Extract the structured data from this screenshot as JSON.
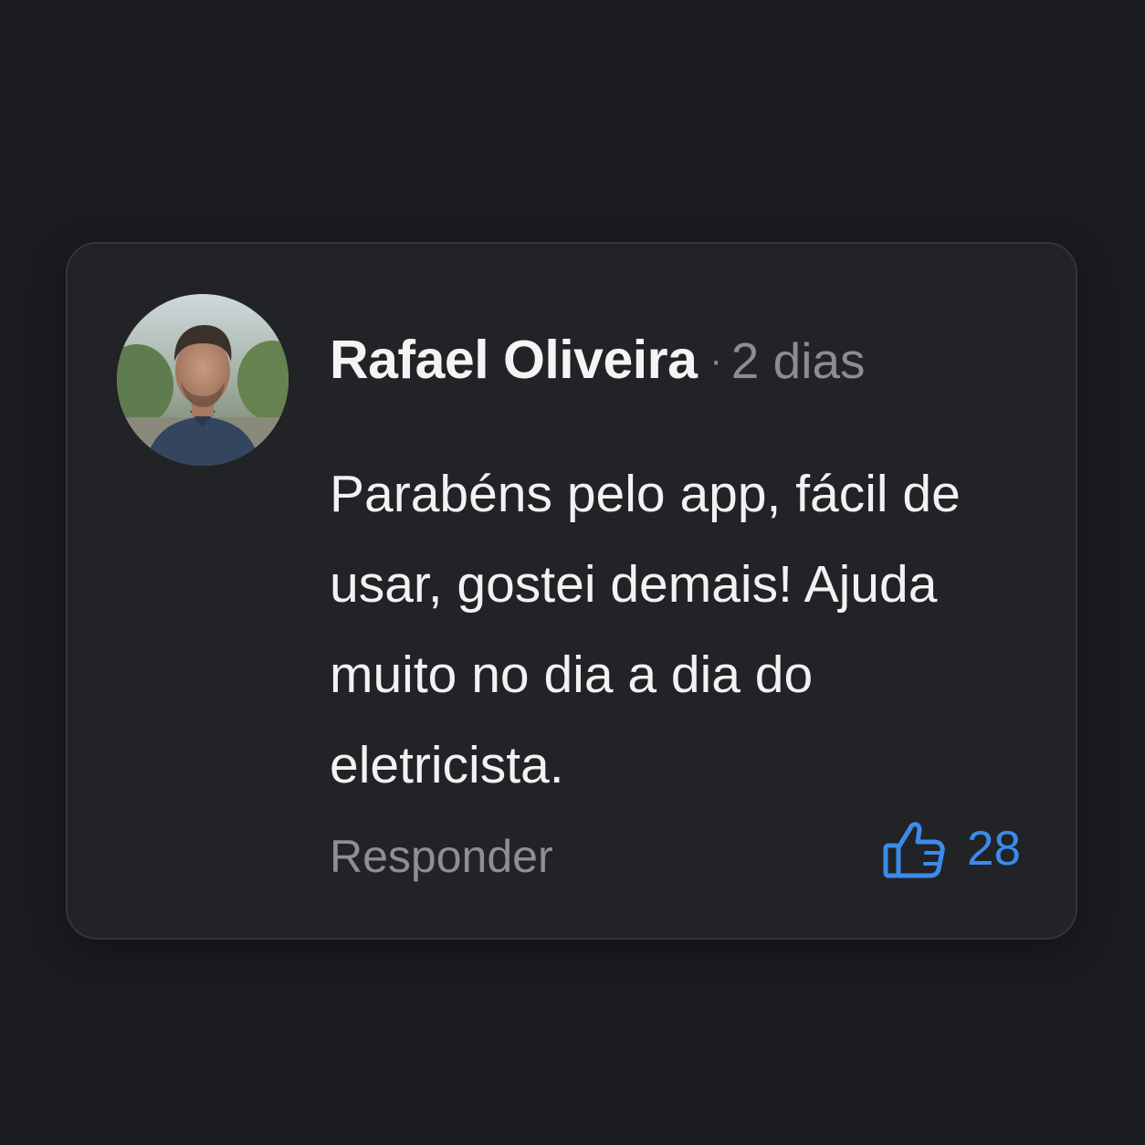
{
  "comment": {
    "author": "Rafael Oliveira",
    "separator": "·",
    "time": "2 dias",
    "text": "Parabéns pelo app, fácil de usar, gostei demais! Ajuda muito no dia a dia do eletricista.",
    "reply_label": "Responder",
    "like_count": "28",
    "like_icon": "thumbs-up-icon",
    "accent_color": "#3b8bea"
  }
}
